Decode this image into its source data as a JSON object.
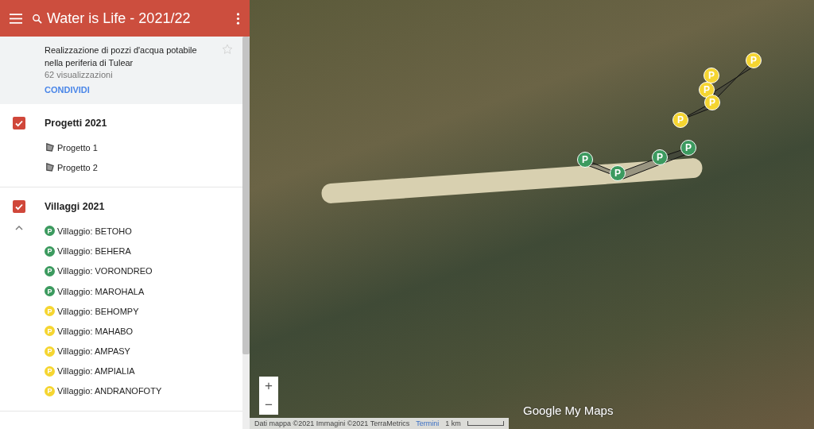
{
  "header": {
    "title": "Water is Life - 2021/22"
  },
  "info": {
    "description": "Realizzazione di pozzi d'acqua potabile nella periferia di Tulear",
    "views": "62 visualizzazioni",
    "share": "CONDIVIDI",
    "starred": false
  },
  "layers": [
    {
      "title": "Progetti 2021",
      "checked": true,
      "items": [
        {
          "kind": "shape",
          "label": "Progetto 1"
        },
        {
          "kind": "shape",
          "label": "Progetto 2"
        }
      ]
    },
    {
      "title": "Villaggi 2021",
      "checked": true,
      "expanded": true,
      "items": [
        {
          "kind": "pin",
          "label": "Villaggio: BETOHO",
          "color": "#3c9a5f",
          "letter": "P"
        },
        {
          "kind": "pin",
          "label": "Villaggio: BEHERA",
          "color": "#3c9a5f",
          "letter": "P"
        },
        {
          "kind": "pin",
          "label": "Villaggio: VORONDREO",
          "color": "#3c9a5f",
          "letter": "P"
        },
        {
          "kind": "pin",
          "label": "Villaggio: MAROHALA",
          "color": "#3c9a5f",
          "letter": "P"
        },
        {
          "kind": "pin",
          "label": "Villaggio: BEHOMPY",
          "color": "#f5d531",
          "letter": "P"
        },
        {
          "kind": "pin",
          "label": "Villaggio: MAHABO",
          "color": "#f5d531",
          "letter": "P"
        },
        {
          "kind": "pin",
          "label": "Villaggio: AMPASY",
          "color": "#f5d531",
          "letter": "P"
        },
        {
          "kind": "pin",
          "label": "Villaggio: AMPIALIA",
          "color": "#f5d531",
          "letter": "P"
        },
        {
          "kind": "pin",
          "label": "Villaggio: ANDRANOFOTY",
          "color": "#f5d531",
          "letter": "P"
        }
      ]
    }
  ],
  "map": {
    "markers": [
      {
        "color": "#f5d531",
        "letter": "P"
      },
      {
        "color": "#f5d531",
        "letter": "P"
      },
      {
        "color": "#f5d531",
        "letter": "P"
      },
      {
        "color": "#f5d531",
        "letter": "P"
      },
      {
        "color": "#f5d531",
        "letter": "P"
      },
      {
        "color": "#3c9a5f",
        "letter": "P"
      },
      {
        "color": "#3c9a5f",
        "letter": "P"
      },
      {
        "color": "#3c9a5f",
        "letter": "P"
      },
      {
        "color": "#3c9a5f",
        "letter": "P"
      }
    ],
    "zoom_in": "+",
    "zoom_out": "−",
    "logo": "Google My Maps",
    "attribution": "Dati mappa ©2021 Immagini ©2021 TerraMetrics",
    "terms": "Termini",
    "scale": "1 km"
  }
}
